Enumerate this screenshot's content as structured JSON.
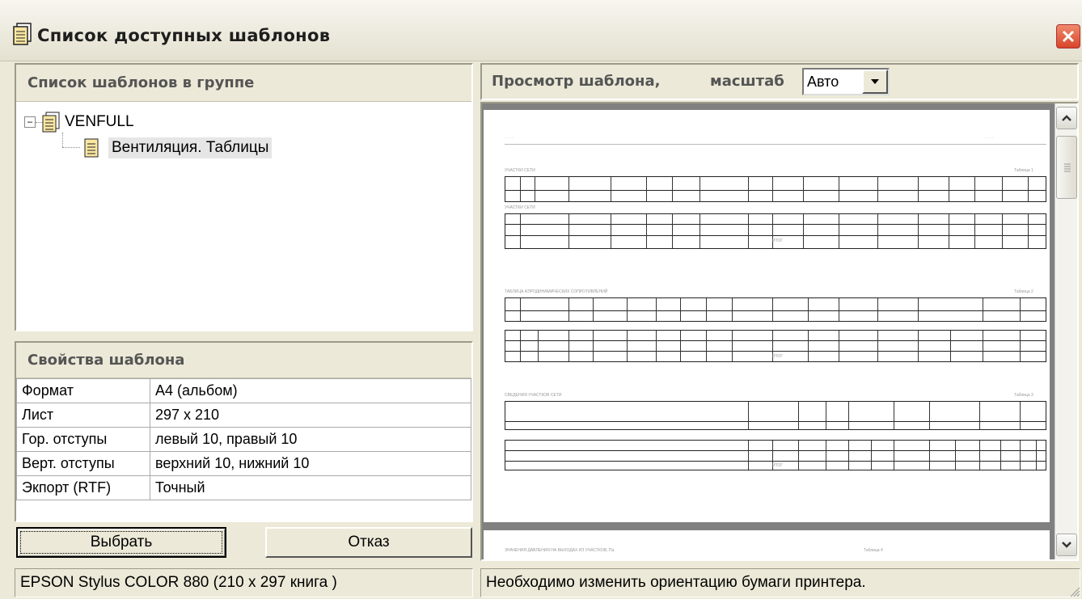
{
  "window": {
    "title": "Список доступных шаблонов"
  },
  "list_panel": {
    "heading": "Список шаблонов в группе",
    "tree": {
      "root": {
        "label": "VENFULL",
        "expanded": true
      },
      "children": [
        {
          "label": "Вентиляция. Таблицы",
          "selected": true
        }
      ]
    }
  },
  "properties": {
    "heading": "Свойства шаблона",
    "rows": [
      {
        "key": "Формат",
        "value": "A4 (альбом)"
      },
      {
        "key": "Лист",
        "value": "297 x 210"
      },
      {
        "key": "Гор. отступы",
        "value": "левый 10,  правый 10"
      },
      {
        "key": "Верт. отступы",
        "value": "верхний 10,  нижний 10"
      },
      {
        "key": "Экпорт (RTF)",
        "value": "Точный"
      }
    ]
  },
  "buttons": {
    "select": "Выбрать",
    "cancel": "Отказ"
  },
  "preview": {
    "heading": "Просмотр шаблона,",
    "scale_label": "масштаб",
    "scale_value": "Авто"
  },
  "status": {
    "printer": "EPSON Stylus COLOR 880 (210 x 297 книга )",
    "message": "Необходимо изменить ориентацию бумаги принтера."
  },
  "page_preview": {
    "section1": "УЧАСТКИ СЕТИ",
    "section1_cont": "УЧАСТКИ СЕТИ",
    "table1": "Таблица 1",
    "section2": "ТАБЛИЦА АЭРОДИНАМИЧЕСКИХ СОПРОТИВЛЕНИЙ",
    "table2": "Таблица 2",
    "section3": "СВЕДЕНИЯ УЧАСТКОВ СЕТИ",
    "table3": "Таблица 3",
    "section4": "ЗНАЧЕНИЯ ДАВЛЕНИЯ НА ВЫХОДАХ ИЗ УЧАСТКОВ, Па",
    "table4": "Таблица 4",
    "total": "ИТОГ"
  },
  "colors": {
    "face": "#ece9d8",
    "close": "#d8452a",
    "preview_bg": "#808080"
  }
}
